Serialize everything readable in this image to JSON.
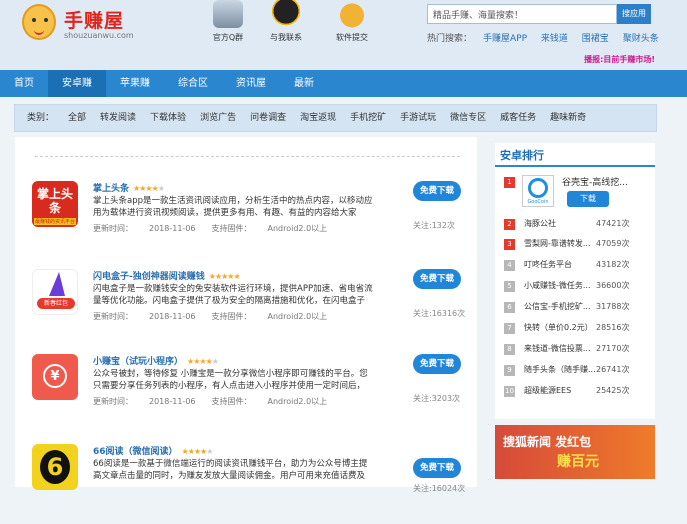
{
  "logo": {
    "text": "手赚屋",
    "url_text": "shouzuanwu.com"
  },
  "top_icons": [
    {
      "label": "官方Q群",
      "icon": "people-icon"
    },
    {
      "label": "与我联系",
      "icon": "qq-penguin-icon"
    },
    {
      "label": "软件提交",
      "icon": "money-bag-icon"
    }
  ],
  "search": {
    "placeholder": "精品手赚、海量搜索！",
    "button": "搜应用"
  },
  "hot": {
    "label": "热门搜索：",
    "items": [
      "手赚屋APP",
      "来钱道",
      "围裙宝",
      "聚财头条"
    ]
  },
  "notice": "播报:目前手赚市场!",
  "nav": [
    "首页",
    "安卓赚",
    "苹果赚",
    "综合区",
    "资讯屋",
    "最新"
  ],
  "categories": [
    "类别：",
    "全部",
    "转发阅读",
    "下载体验",
    "浏览广告",
    "问卷调查",
    "淘宝返现",
    "手机挖矿",
    "手游试玩",
    "微信专区",
    "威客任务",
    "趣味新奇"
  ],
  "apps": [
    {
      "title": "掌上头条",
      "rating": 4,
      "desc": "掌上头条app是一款生活资讯阅读应用，分析生活中的热点内容，以移动应用为载体进行资讯视频阅读，提供更多有用、有趣、有益的内容给大家",
      "date_label": "更新时间：",
      "date": "2018-11-06",
      "firm_label": "支持固件：",
      "firm": "Android2.0以上",
      "dl": "免费下载",
      "att": "关注:132次",
      "thumb_text": "掌上头条",
      "thumb_sub": "最赚钱的资讯平台"
    },
    {
      "title": "闪电盒子-独创神器阅读赚钱",
      "rating": 5,
      "desc": "闪电盒子是一款赚钱安全的免安装软件运行环境，提供APP加速、省电省流量等优化功能。闪电盒子提供了极为安全的隔离措施和优化，在闪电盒子里运行",
      "date_label": "更新时间：",
      "date": "2018-11-06",
      "firm_label": "支持固件：",
      "firm": "Android2.0以上",
      "dl": "免费下载",
      "att": "关注:16316次",
      "thumb_text": "新春红包"
    },
    {
      "title": "小赚宝（试玩小程序）",
      "rating": 4,
      "desc": "公众号被封，等待修复 小赚宝是一款分享微信小程序即可赚钱的平台。您只需要分享任务列表的小程序，有人点击进入小程序并使用一定时间后，",
      "date_label": "更新时间：",
      "date": "2018-11-06",
      "firm_label": "支持固件：",
      "firm": "Android2.0以上",
      "dl": "免费下载",
      "att": "关注:3203次",
      "thumb_text": "¥"
    },
    {
      "title": "66阅读（微信阅读）",
      "rating": 4,
      "desc": "66阅读是一款基于微信端运行的阅读资讯赚钱平台，助力为公众号博主提高文章点击量的同时，为赚友发放大量阅读佣金。用户可用来充值话费及使用支",
      "date_label": "",
      "date": "",
      "firm_label": "",
      "firm": "",
      "dl": "免费下载",
      "att": "关注:16024次",
      "thumb_text": "6"
    }
  ],
  "sidebar": {
    "title": "安卓排行",
    "top": {
      "name": "谷壳宝-高线挖...",
      "dl": "下载",
      "logo": "GooCoin"
    },
    "ranks": [
      {
        "n": "2",
        "name": "海豚公社",
        "count": "47421次"
      },
      {
        "n": "3",
        "name": "雪梨网-靠谱转发...",
        "count": "47059次"
      },
      {
        "n": "4",
        "name": "叮咚任务平台",
        "count": "43182次"
      },
      {
        "n": "5",
        "name": "小咸赚钱-微任务...",
        "count": "36600次"
      },
      {
        "n": "6",
        "name": "公信宝-手机挖矿...",
        "count": "31788次"
      },
      {
        "n": "7",
        "name": "快转（单价0.2元）",
        "count": "28516次"
      },
      {
        "n": "8",
        "name": "来钱道-微信投票...",
        "count": "27170次"
      },
      {
        "n": "9",
        "name": "随手头条（随手赚...",
        "count": "26741次"
      },
      {
        "n": "10",
        "name": "超级能源EES",
        "count": "25425次"
      }
    ]
  },
  "banner": {
    "line1": "搜狐新闻 发红包",
    "line2": "赚百元"
  },
  "colors": {
    "nav": "#2a86cf",
    "nav_active": "#1b6fb4",
    "download": "#2286d8",
    "logo": "#e2231a",
    "notice": "#d0188c"
  }
}
